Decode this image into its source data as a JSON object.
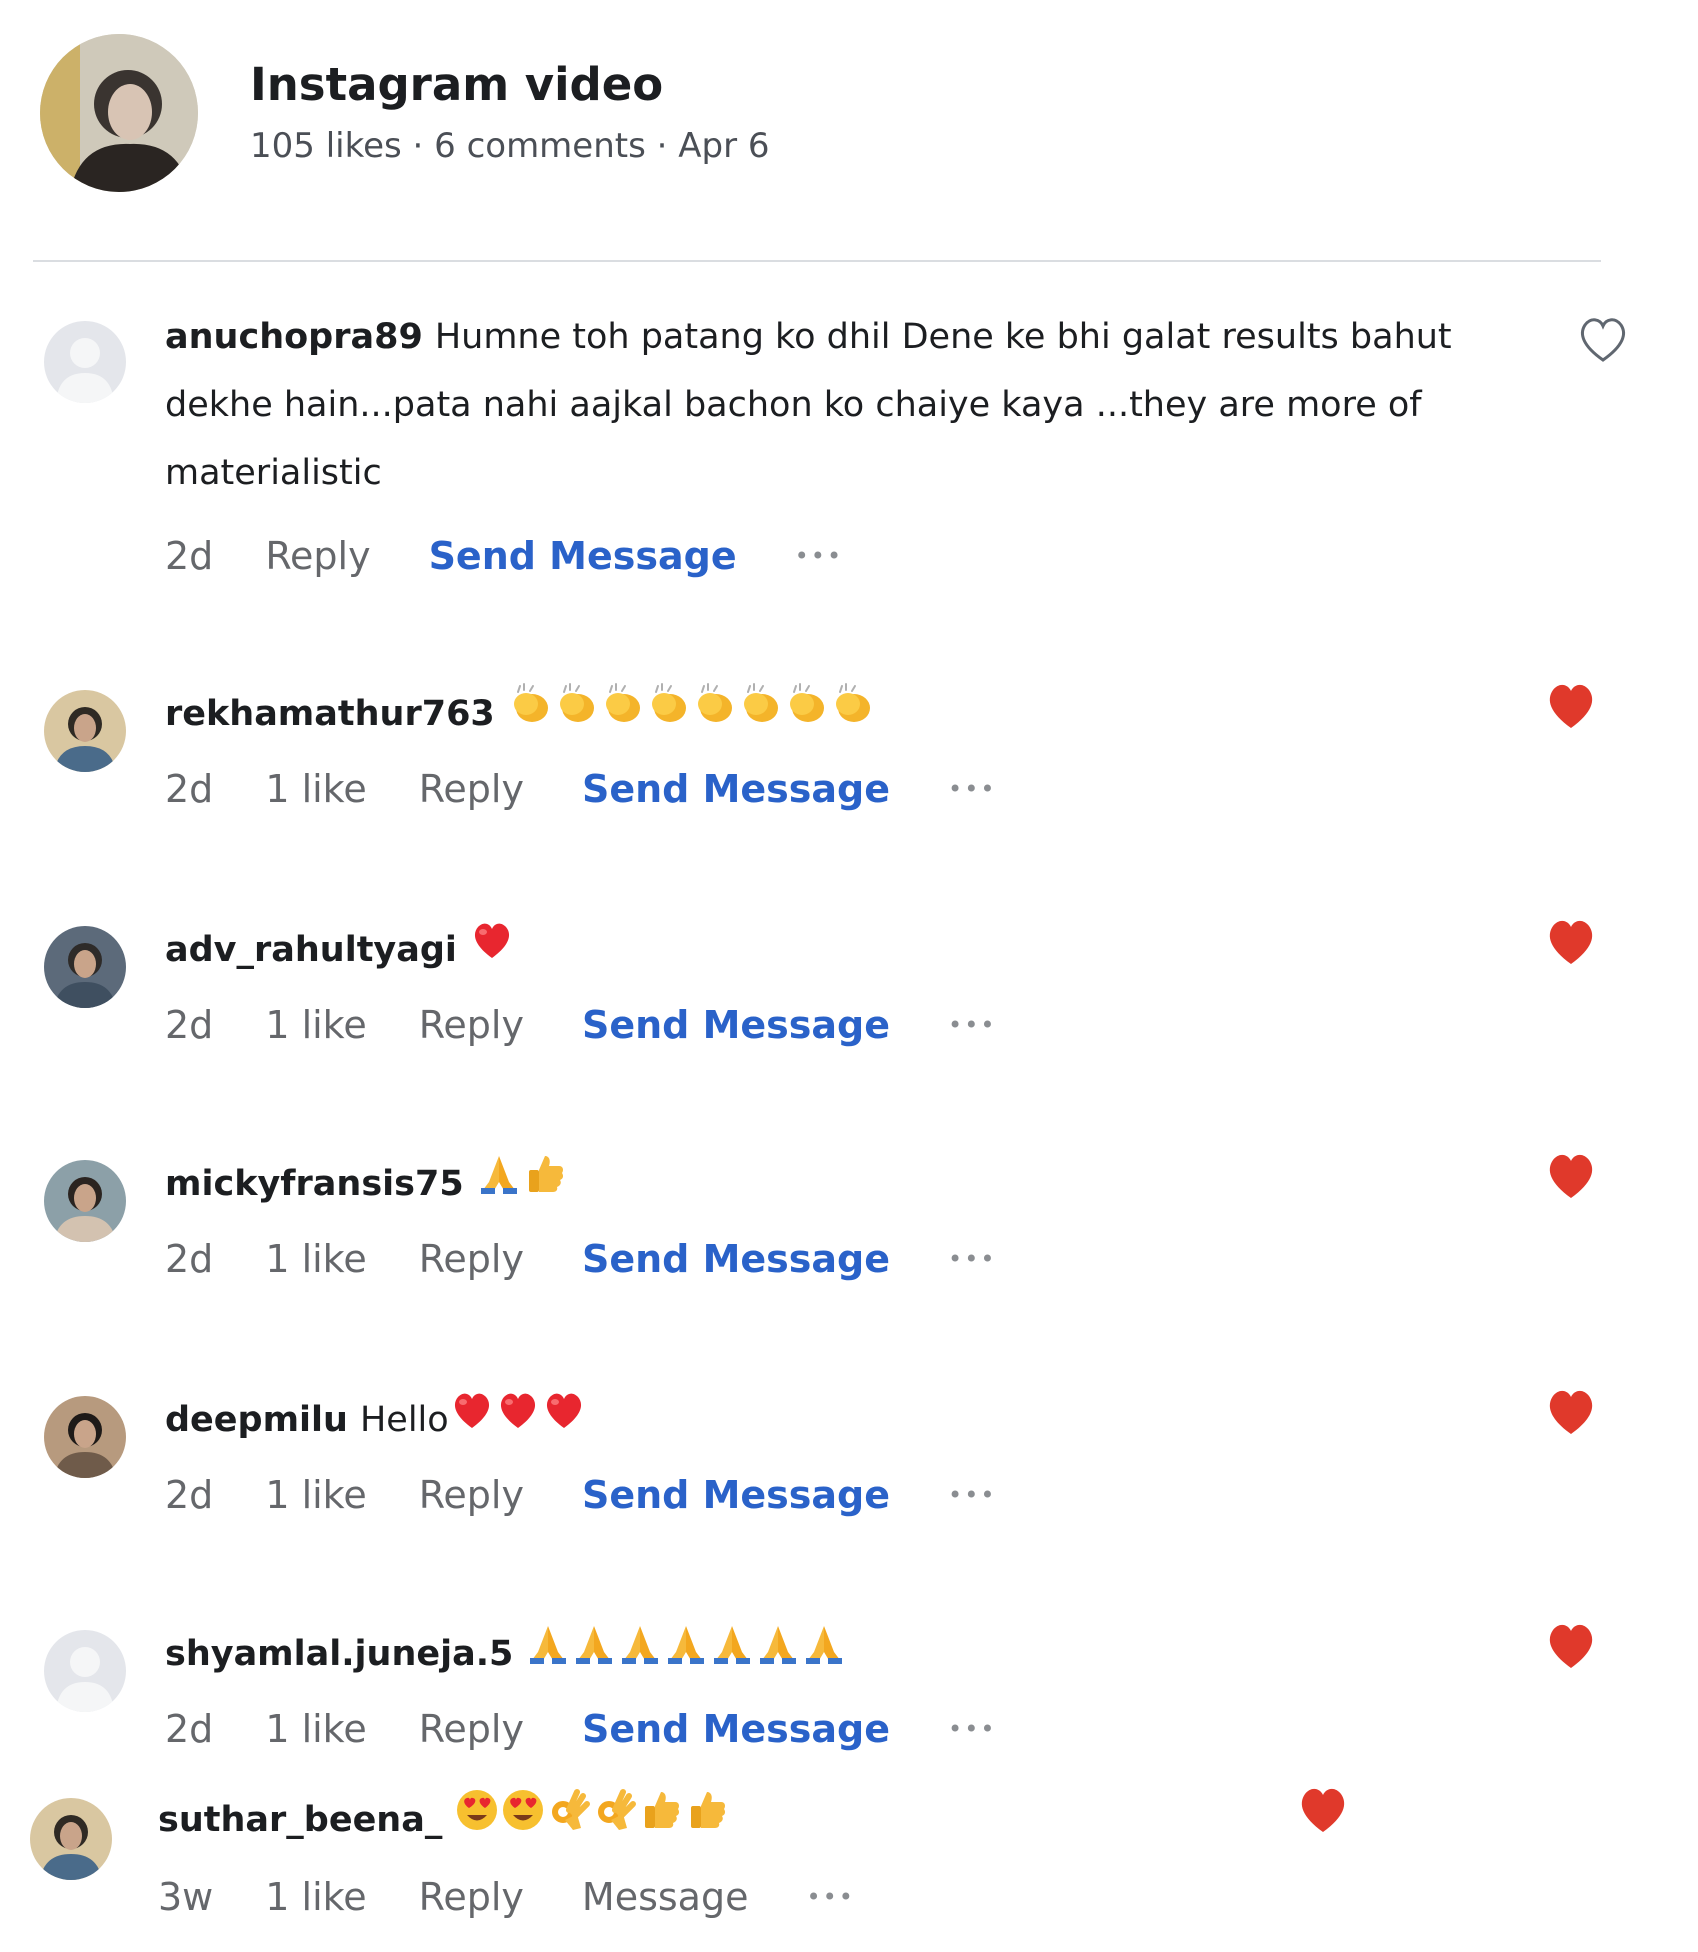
{
  "post": {
    "title": "Instagram video",
    "meta": "105 likes · 6 comments · Apr 6"
  },
  "colors": {
    "link_blue": "#2a62c9",
    "muted_gray": "#65676b",
    "heart_red": "#e0392b",
    "divider": "#dadde1"
  },
  "comments": [
    {
      "username": "anuchopra89",
      "text": "Humne toh patang ko dhil Dene ke bhi galat results bahut dekhe hain...pata nahi aajkal bachon ko chaiye kaya ...they are more of materialistic",
      "emojis": [],
      "time": "2d",
      "likes": "",
      "reply": "Reply",
      "message": "Send Message",
      "more": "•••",
      "liked": false,
      "avatar": "placeholder-avatar"
    },
    {
      "username": "rekhamathur763",
      "text": "",
      "emojis": [
        "clap",
        "clap",
        "clap",
        "clap",
        "clap",
        "clap",
        "clap",
        "clap"
      ],
      "time": "2d",
      "likes": "1 like",
      "reply": "Reply",
      "message": "Send Message",
      "more": "•••",
      "liked": true,
      "avatar": "user-photo-avatar"
    },
    {
      "username": "adv_rahultyagi",
      "text": "",
      "emojis": [
        "red-heart"
      ],
      "time": "2d",
      "likes": "1 like",
      "reply": "Reply",
      "message": "Send Message",
      "more": "•••",
      "liked": true,
      "avatar": "user-photo-avatar"
    },
    {
      "username": "mickyfransis75",
      "text": "",
      "emojis": [
        "folded-hands",
        "thumbs-up"
      ],
      "time": "2d",
      "likes": "1 like",
      "reply": "Reply",
      "message": "Send Message",
      "more": "•••",
      "liked": true,
      "avatar": "user-photo-avatar"
    },
    {
      "username": "deepmilu",
      "text": "Hello",
      "emojis": [
        "red-heart",
        "red-heart",
        "red-heart"
      ],
      "time": "2d",
      "likes": "1 like",
      "reply": "Reply",
      "message": "Send Message",
      "more": "•••",
      "liked": true,
      "avatar": "user-photo-avatar"
    },
    {
      "username": "shyamlal.juneja.5",
      "text": "",
      "emojis": [
        "folded-hands",
        "folded-hands",
        "folded-hands",
        "folded-hands",
        "folded-hands",
        "folded-hands",
        "folded-hands"
      ],
      "time": "2d",
      "likes": "1 like",
      "reply": "Reply",
      "message": "Send Message",
      "more": "•••",
      "liked": true,
      "avatar": "placeholder-avatar"
    },
    {
      "username": "suthar_beena_",
      "text": "",
      "emojis": [
        "heart-eyes",
        "heart-eyes",
        "ok-hand",
        "ok-hand",
        "thumbs-up",
        "thumbs-up"
      ],
      "time": "3w",
      "likes": "1 like",
      "reply": "Reply",
      "message": "Message",
      "more": "•••",
      "liked": true,
      "avatar": "user-photo-avatar"
    }
  ]
}
